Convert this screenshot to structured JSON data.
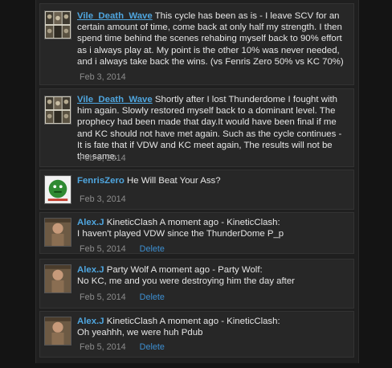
{
  "comments": [
    {
      "author": "Vile_Death_Wave",
      "text": "This cycle has been as is - I leave SCV for an certain amount of time, come back at only half my strength. I then spend time behind the scenes rehabing myself back to 90% effort as i always play at. My point is the other 10% was never needed, and i always take back the wins. (vs Fenris Zero 50% vs KC 70%)",
      "date": "Feb 3, 2014",
      "avatar": "vile-avatar-icon"
    },
    {
      "author": "Vile_Death_Wave",
      "text": "Shortly after I lost Thunderdome I fought with him again. Slowly restored myself back to a dominant level. The prophecy had been made that day.It would have been final if me and KC should not have met again. Such as the cycle continues - It is fate that if VDW and KC meet again, The results will not be the same.",
      "date": "Feb 3, 2014",
      "avatar": "vile-avatar-icon"
    },
    {
      "author": "FenrisZero",
      "text": "He Will Beat Your Ass?",
      "date": "Feb 3, 2014",
      "avatar": "fenris-avatar-icon"
    },
    {
      "author": "Alex.J",
      "text": "KineticClash A moment ago - KineticClash:",
      "text2": "I haven't played VDW since the ThunderDome P_p",
      "date": "Feb 5, 2014",
      "delete": "Delete",
      "avatar": "alex-avatar-icon"
    },
    {
      "author": "Alex.J",
      "text": "Party Wolf A moment ago - Party Wolf:",
      "text2": "No KC, me and you were destroying him the day after",
      "date": "Feb 5, 2014",
      "delete": "Delete",
      "avatar": "alex-avatar-icon"
    },
    {
      "author": "Alex.J",
      "text": "KineticClash A moment ago - KineticClash:",
      "text2": "Oh yeahhh, we were huh Pdub",
      "date": "Feb 5, 2014",
      "delete": "Delete",
      "avatar": "alex-avatar-icon"
    }
  ]
}
